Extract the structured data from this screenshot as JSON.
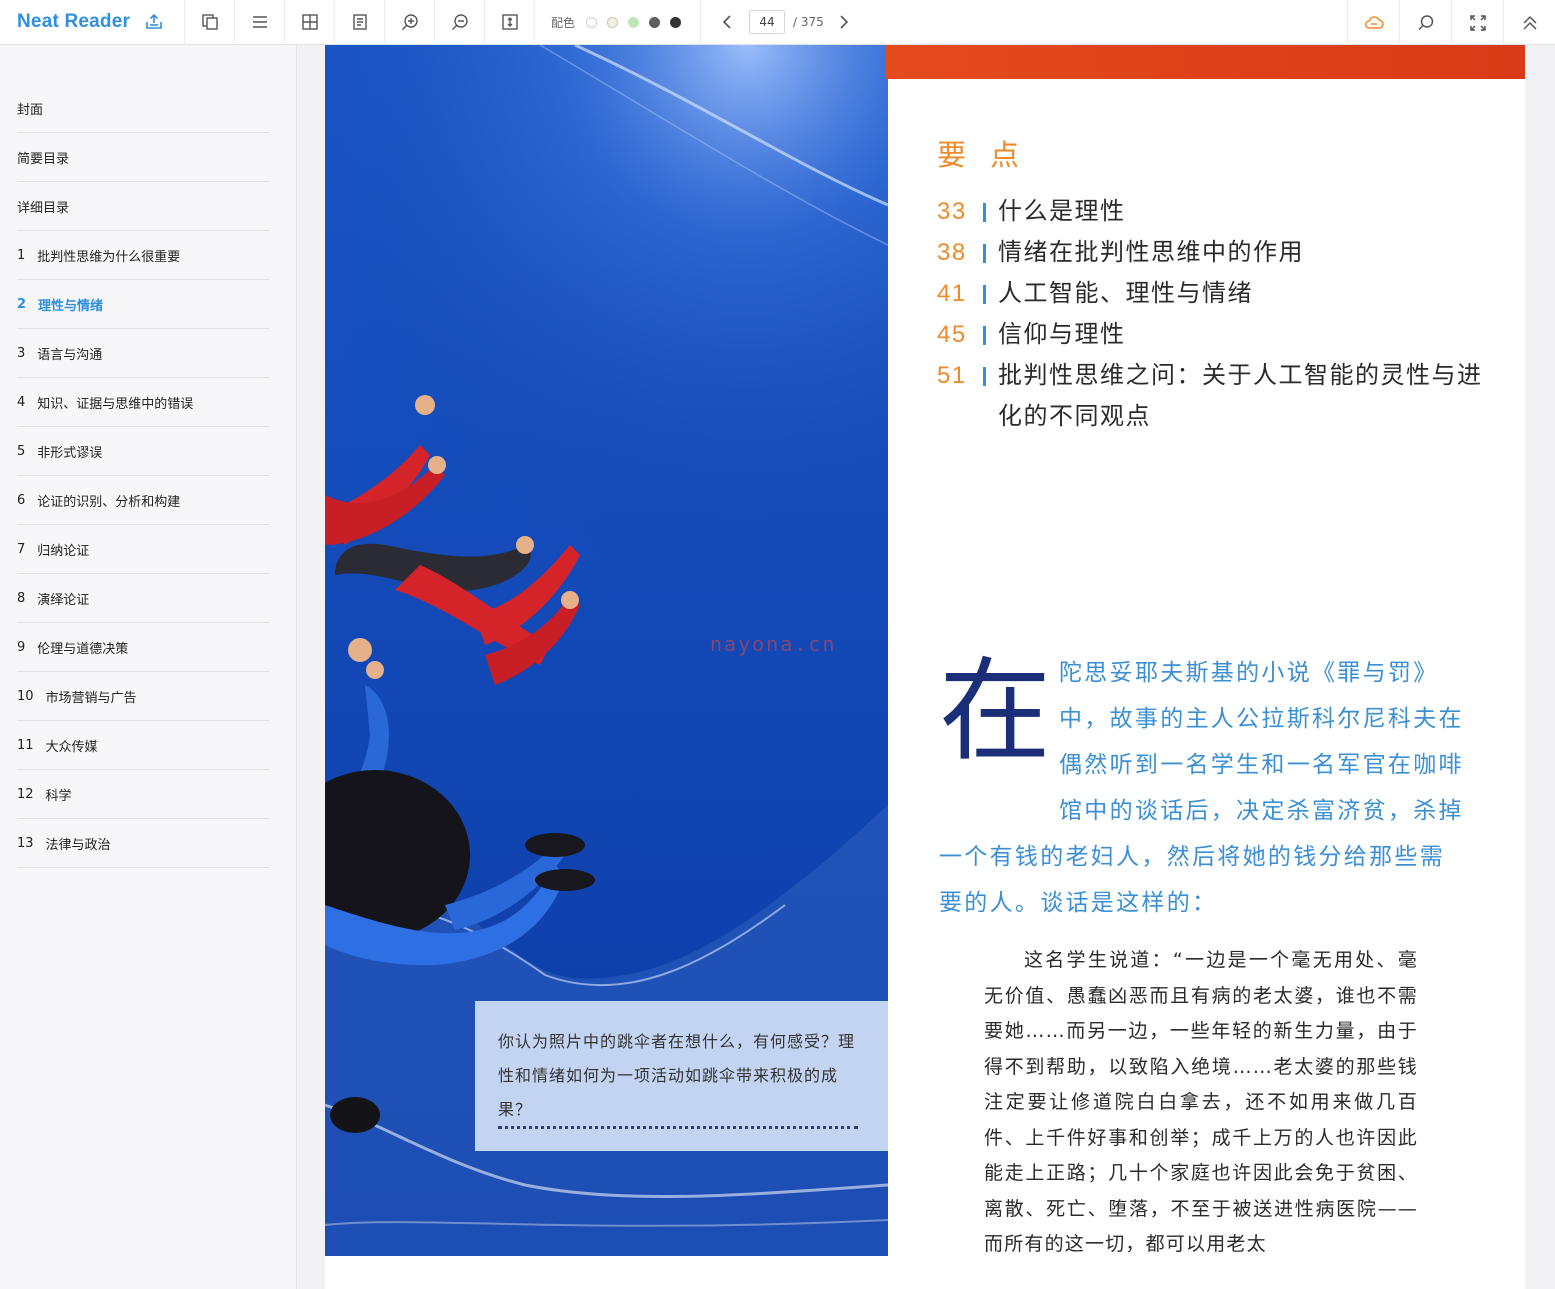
{
  "app": {
    "name": "Neat Reader"
  },
  "toolbar": {
    "theme_label": "配色",
    "theme_colors": [
      "#ffffff",
      "#f4f1e4",
      "#bfe6b4",
      "#5e5e5e",
      "#333333"
    ],
    "current_page": "44",
    "total_pages": "/ 375"
  },
  "sidebar": {
    "items": [
      {
        "num": "",
        "label": "封面"
      },
      {
        "num": "",
        "label": "简要目录"
      },
      {
        "num": "",
        "label": "详细目录"
      },
      {
        "num": "1",
        "label": "批判性思维为什么很重要"
      },
      {
        "num": "2",
        "label": "理性与情绪",
        "active": true
      },
      {
        "num": "3",
        "label": "语言与沟通"
      },
      {
        "num": "4",
        "label": "知识、证据与思维中的错误"
      },
      {
        "num": "5",
        "label": "非形式谬误"
      },
      {
        "num": "6",
        "label": "论证的识别、分析和构建"
      },
      {
        "num": "7",
        "label": "归纳论证"
      },
      {
        "num": "8",
        "label": "演绎论证"
      },
      {
        "num": "9",
        "label": "伦理与道德决策"
      },
      {
        "num": "10",
        "label": "市场营销与广告"
      },
      {
        "num": "11",
        "label": "大众传媒"
      },
      {
        "num": "12",
        "label": "科学"
      },
      {
        "num": "13",
        "label": "法律与政治"
      }
    ]
  },
  "page": {
    "heading": "要点",
    "points": [
      {
        "num": "33",
        "text": "什么是理性"
      },
      {
        "num": "38",
        "text": "情绪在批判性思维中的作用"
      },
      {
        "num": "41",
        "text": "人工智能、理性与情绪"
      },
      {
        "num": "45",
        "text": "信仰与理性"
      },
      {
        "num": "51",
        "text": "批判性思维之问：关于人工智能的灵性与进化的不同观点"
      }
    ],
    "watermark": "nayona.cn",
    "caption": "你认为照片中的跳伞者在想什么，有何感受？理性和情绪如何为一项活动如跳伞带来积极的成果？",
    "dropcap": "在",
    "intro": "陀思妥耶夫斯基的小说《罪与罚》中，故事的主人公拉斯科尔尼科夫在偶然听到一名学生和一名军官在咖啡馆中的谈话后，决定杀富济贫，杀掉一个有钱的老妇人，然后将她的钱分给那些需要的人。谈话是这样的：",
    "quote": "这名学生说道：“一边是一个毫无用处、毫无价值、愚蠢凶恶而且有病的老太婆，谁也不需要她……而另一边，一些年轻的新生力量，由于得不到帮助，以致陷入绝境……老太婆的那些钱注定要让修道院白白拿去，还不如用来做几百件、上千件好事和创举；成千上万的人也许因此能走上正路；几十个家庭也许因此会免于贫困、离散、死亡、堕落，不至于被送进性病医院——而所有的这一切，都可以用老太"
  },
  "colors": {
    "accent": "#2f8fe0",
    "orange": "#ee8a2a",
    "banner": "#e54a1d",
    "dropcap": "#1a2f78",
    "intro": "#3b8fd4"
  }
}
